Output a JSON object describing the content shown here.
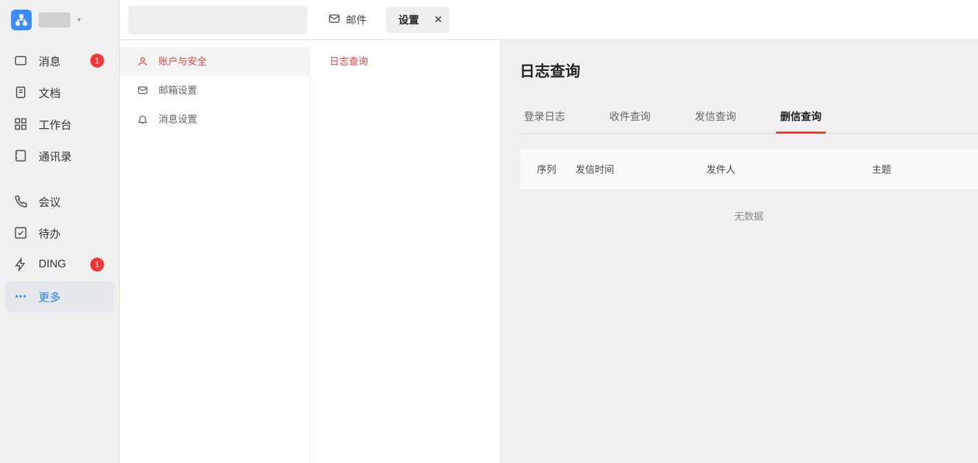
{
  "sidebar": {
    "items": [
      {
        "label": "消息",
        "badge": "1"
      },
      {
        "label": "文档"
      },
      {
        "label": "工作台"
      },
      {
        "label": "通讯录"
      },
      {
        "label": "会议"
      },
      {
        "label": "待办"
      },
      {
        "label": "DING",
        "badge": "1"
      },
      {
        "label": "更多"
      }
    ]
  },
  "topbar": {
    "tabs": [
      {
        "label": "邮件"
      },
      {
        "label": "设置",
        "close": "✕"
      }
    ]
  },
  "settings": {
    "items": [
      {
        "label": "账户与安全"
      },
      {
        "label": "邮箱设置"
      },
      {
        "label": "消息设置"
      }
    ]
  },
  "sub": {
    "item": "日志查询"
  },
  "detail": {
    "title": "日志查询",
    "tabs": [
      "登录日志",
      "收件查询",
      "发信查询",
      "删信查询"
    ],
    "columns": [
      "序列",
      "发信时间",
      "发件人",
      "主题"
    ],
    "no_data": "无数据"
  }
}
